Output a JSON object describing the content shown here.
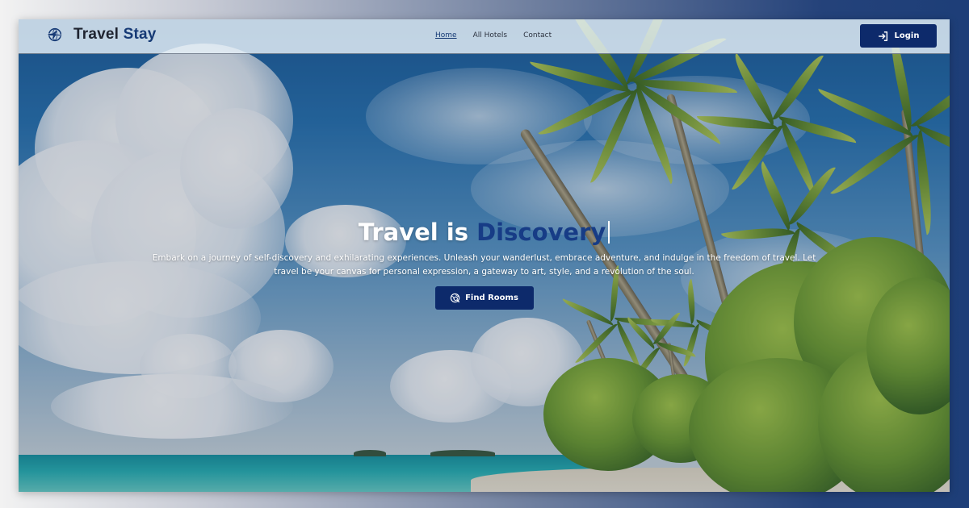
{
  "navbar": {
    "brand_part1": "Travel",
    "brand_part2": "Stay",
    "links": [
      {
        "label": "Home",
        "active": true
      },
      {
        "label": "All Hotels",
        "active": false
      },
      {
        "label": "Contact",
        "active": false
      }
    ],
    "login_label": "Login",
    "icons": {
      "brand": "plane-globe-icon",
      "login": "login-arrow-icon"
    }
  },
  "hero": {
    "title_static": "Travel is",
    "title_accent": "Discovery",
    "subtitle": "Embark on a journey of self-discovery and exhilarating experiences. Unleash your wanderlust, embrace adventure, and indulge in the freedom of travel. Let travel be your canvas for personal expression, a gateway to art, style, and a revolution of the soul.",
    "cta_label": "Find Rooms",
    "cta_icon": "search-globe-icon",
    "background_image": "tropical beach with palm trees and clouds"
  },
  "colors": {
    "primary": "#0d2a6b",
    "accent_text": "#173c86",
    "brand_dark": "#1f2430"
  }
}
